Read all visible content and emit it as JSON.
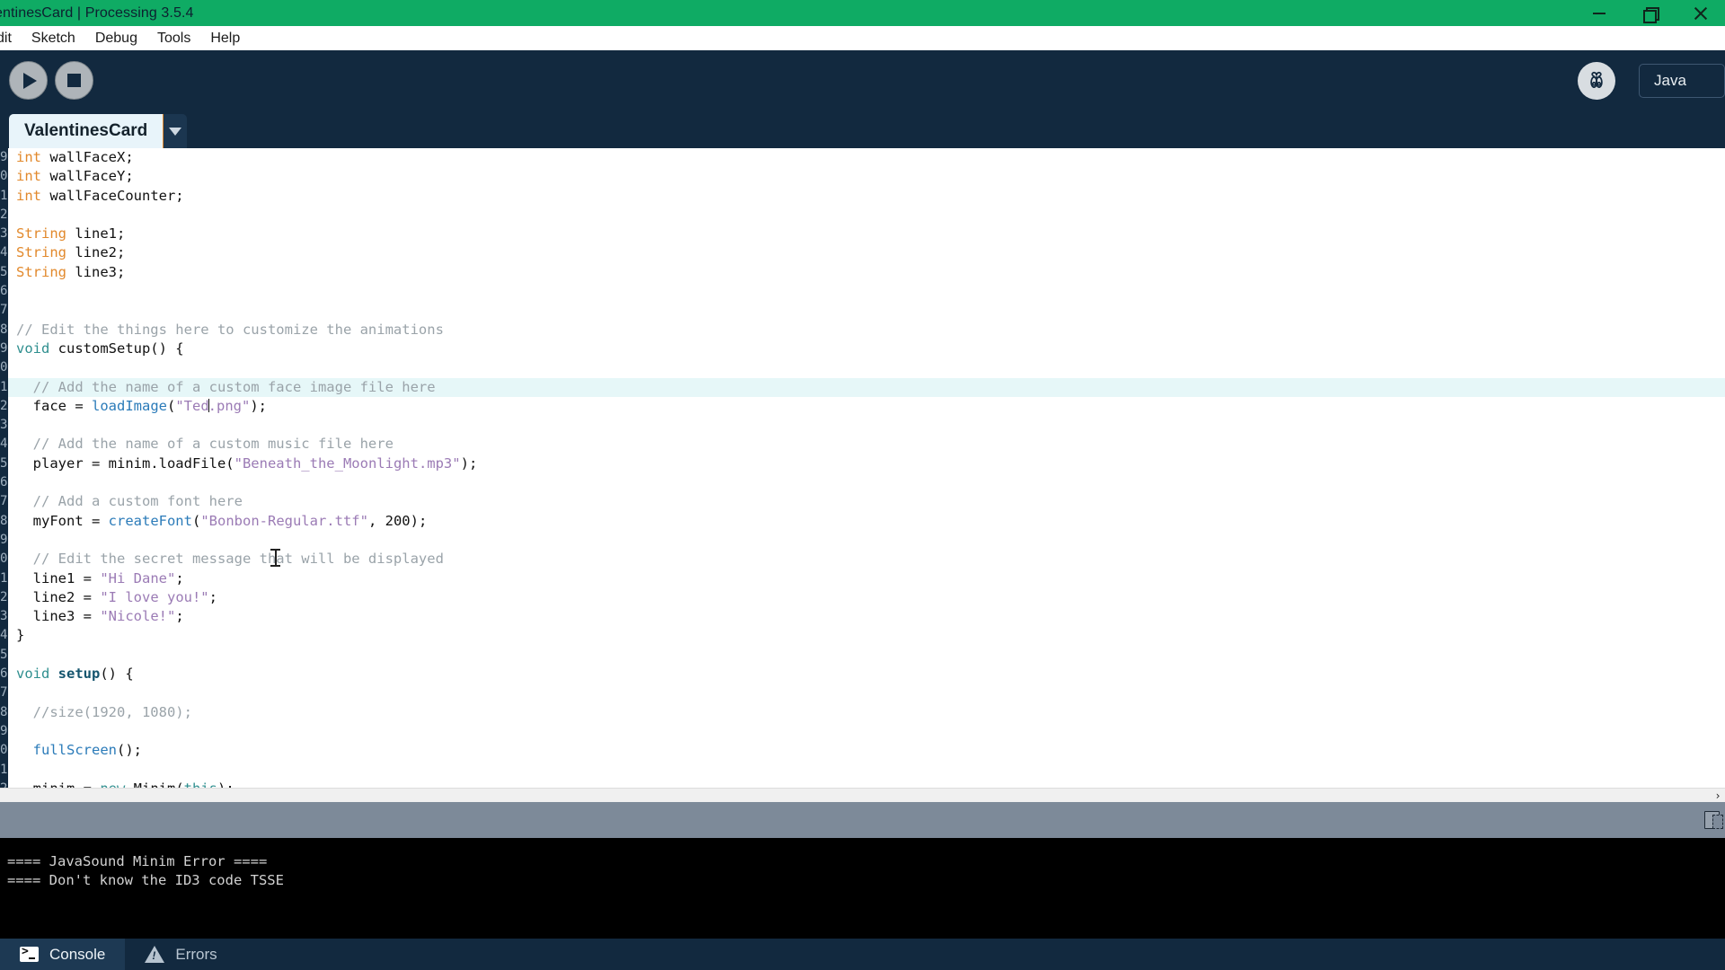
{
  "window": {
    "title": "entinesCard | Processing 3.5.4",
    "titlebar_color": "#0fab64",
    "controls": [
      {
        "name": "minimize-button",
        "icon": "minimize-icon"
      },
      {
        "name": "restore-button",
        "icon": "restore-icon"
      },
      {
        "name": "close-button",
        "icon": "close-icon"
      }
    ]
  },
  "menubar": {
    "items": [
      "dit",
      "Sketch",
      "Debug",
      "Tools",
      "Help"
    ]
  },
  "toolbar": {
    "run_label": "Run",
    "stop_label": "Stop",
    "debug_label": "Debugger",
    "mode_label": "Java",
    "background": "#12293f"
  },
  "tabstrip": {
    "sketch_tab": "ValentinesCard",
    "tab_accent": "#e2892c",
    "menu_icon": "chevron-down-icon"
  },
  "editor": {
    "gutter_numbers": [
      "9",
      "0",
      "1",
      "2",
      "3",
      "4",
      "5",
      "6",
      "7",
      "8",
      "9",
      "0",
      "1",
      "2",
      "3",
      "4",
      "5",
      "6",
      "7",
      "8",
      "9",
      "0",
      "1",
      "2",
      "3",
      "4",
      "5",
      "6",
      "7",
      "8",
      "9",
      "0",
      "1",
      "2"
    ],
    "current_line_index": 12,
    "lines": [
      [
        {
          "t": "int",
          "c": "k-type"
        },
        {
          "t": " wallFaceX;",
          "c": ""
        }
      ],
      [
        {
          "t": "int",
          "c": "k-type"
        },
        {
          "t": " wallFaceY;",
          "c": ""
        }
      ],
      [
        {
          "t": "int",
          "c": "k-type"
        },
        {
          "t": " wallFaceCounter;",
          "c": ""
        }
      ],
      [
        {
          "t": "",
          "c": ""
        }
      ],
      [
        {
          "t": "String",
          "c": "k-type"
        },
        {
          "t": " line1;",
          "c": ""
        }
      ],
      [
        {
          "t": "String",
          "c": "k-type"
        },
        {
          "t": " line2;",
          "c": ""
        }
      ],
      [
        {
          "t": "String",
          "c": "k-type"
        },
        {
          "t": " line3;",
          "c": ""
        }
      ],
      [
        {
          "t": "",
          "c": ""
        }
      ],
      [
        {
          "t": "",
          "c": ""
        }
      ],
      [
        {
          "t": "// Edit the things here to customize the animations",
          "c": "k-com"
        }
      ],
      [
        {
          "t": "void",
          "c": "k-void"
        },
        {
          "t": " customSetup() {",
          "c": ""
        }
      ],
      [
        {
          "t": "",
          "c": ""
        }
      ],
      [
        {
          "t": "  // Add the name of a custom face image file here",
          "c": "k-com"
        }
      ],
      [
        {
          "t": "  face = ",
          "c": ""
        },
        {
          "t": "loadImage",
          "c": "k-fn"
        },
        {
          "t": "(",
          "c": ""
        },
        {
          "t": "\"Ted",
          "c": "k-str"
        },
        {
          "t": "|CARET|",
          "c": "caret"
        },
        {
          "t": ".png\"",
          "c": "k-str"
        },
        {
          "t": ");",
          "c": ""
        }
      ],
      [
        {
          "t": "",
          "c": ""
        }
      ],
      [
        {
          "t": "  // Add the name of a custom music file here",
          "c": "k-com"
        }
      ],
      [
        {
          "t": "  player = minim.loadFile(",
          "c": ""
        },
        {
          "t": "\"Beneath_the_Moonlight.mp3\"",
          "c": "k-str"
        },
        {
          "t": ");",
          "c": ""
        }
      ],
      [
        {
          "t": "",
          "c": ""
        }
      ],
      [
        {
          "t": "  // Add a custom font here",
          "c": "k-com"
        }
      ],
      [
        {
          "t": "  myFont = ",
          "c": ""
        },
        {
          "t": "createFont",
          "c": "k-fn"
        },
        {
          "t": "(",
          "c": ""
        },
        {
          "t": "\"Bonbon-Regular.ttf\"",
          "c": "k-str"
        },
        {
          "t": ", 200);",
          "c": ""
        }
      ],
      [
        {
          "t": "",
          "c": ""
        }
      ],
      [
        {
          "t": "  // Edit the secret message that will be displayed",
          "c": "k-com"
        }
      ],
      [
        {
          "t": "  line1 = ",
          "c": ""
        },
        {
          "t": "\"Hi Dane\"",
          "c": "k-str"
        },
        {
          "t": ";",
          "c": ""
        }
      ],
      [
        {
          "t": "  line2 = ",
          "c": ""
        },
        {
          "t": "\"I love you!\"",
          "c": "k-str"
        },
        {
          "t": ";",
          "c": ""
        }
      ],
      [
        {
          "t": "  line3 = ",
          "c": ""
        },
        {
          "t": "\"Nicole!\"",
          "c": "k-str"
        },
        {
          "t": ";",
          "c": ""
        }
      ],
      [
        {
          "t": "}",
          "c": ""
        }
      ],
      [
        {
          "t": "",
          "c": ""
        }
      ],
      [
        {
          "t": "void",
          "c": "k-void"
        },
        {
          "t": " ",
          "c": ""
        },
        {
          "t": "setup",
          "c": "k-fnb"
        },
        {
          "t": "() {",
          "c": ""
        }
      ],
      [
        {
          "t": "",
          "c": ""
        }
      ],
      [
        {
          "t": "  //size(1920, 1080);",
          "c": "k-com"
        }
      ],
      [
        {
          "t": "",
          "c": ""
        }
      ],
      [
        {
          "t": "  ",
          "c": ""
        },
        {
          "t": "fullScreen",
          "c": "k-fn"
        },
        {
          "t": "();",
          "c": ""
        }
      ],
      [
        {
          "t": "",
          "c": ""
        }
      ],
      [
        {
          "t": "  minim = ",
          "c": ""
        },
        {
          "t": "new",
          "c": "k-new"
        },
        {
          "t": " Minim(",
          "c": ""
        },
        {
          "t": "this",
          "c": "k-this"
        },
        {
          "t": ");",
          "c": ""
        }
      ]
    ],
    "scrollbar_arrow": "›"
  },
  "console": {
    "lines": [
      "==== JavaSound Minim Error ====",
      "==== Don't know the ID3 code TSSE"
    ]
  },
  "bottom_tabs": [
    {
      "label": "Console",
      "icon": "terminal-icon",
      "active": true
    },
    {
      "label": "Errors",
      "icon": "warning-icon",
      "active": false
    }
  ]
}
